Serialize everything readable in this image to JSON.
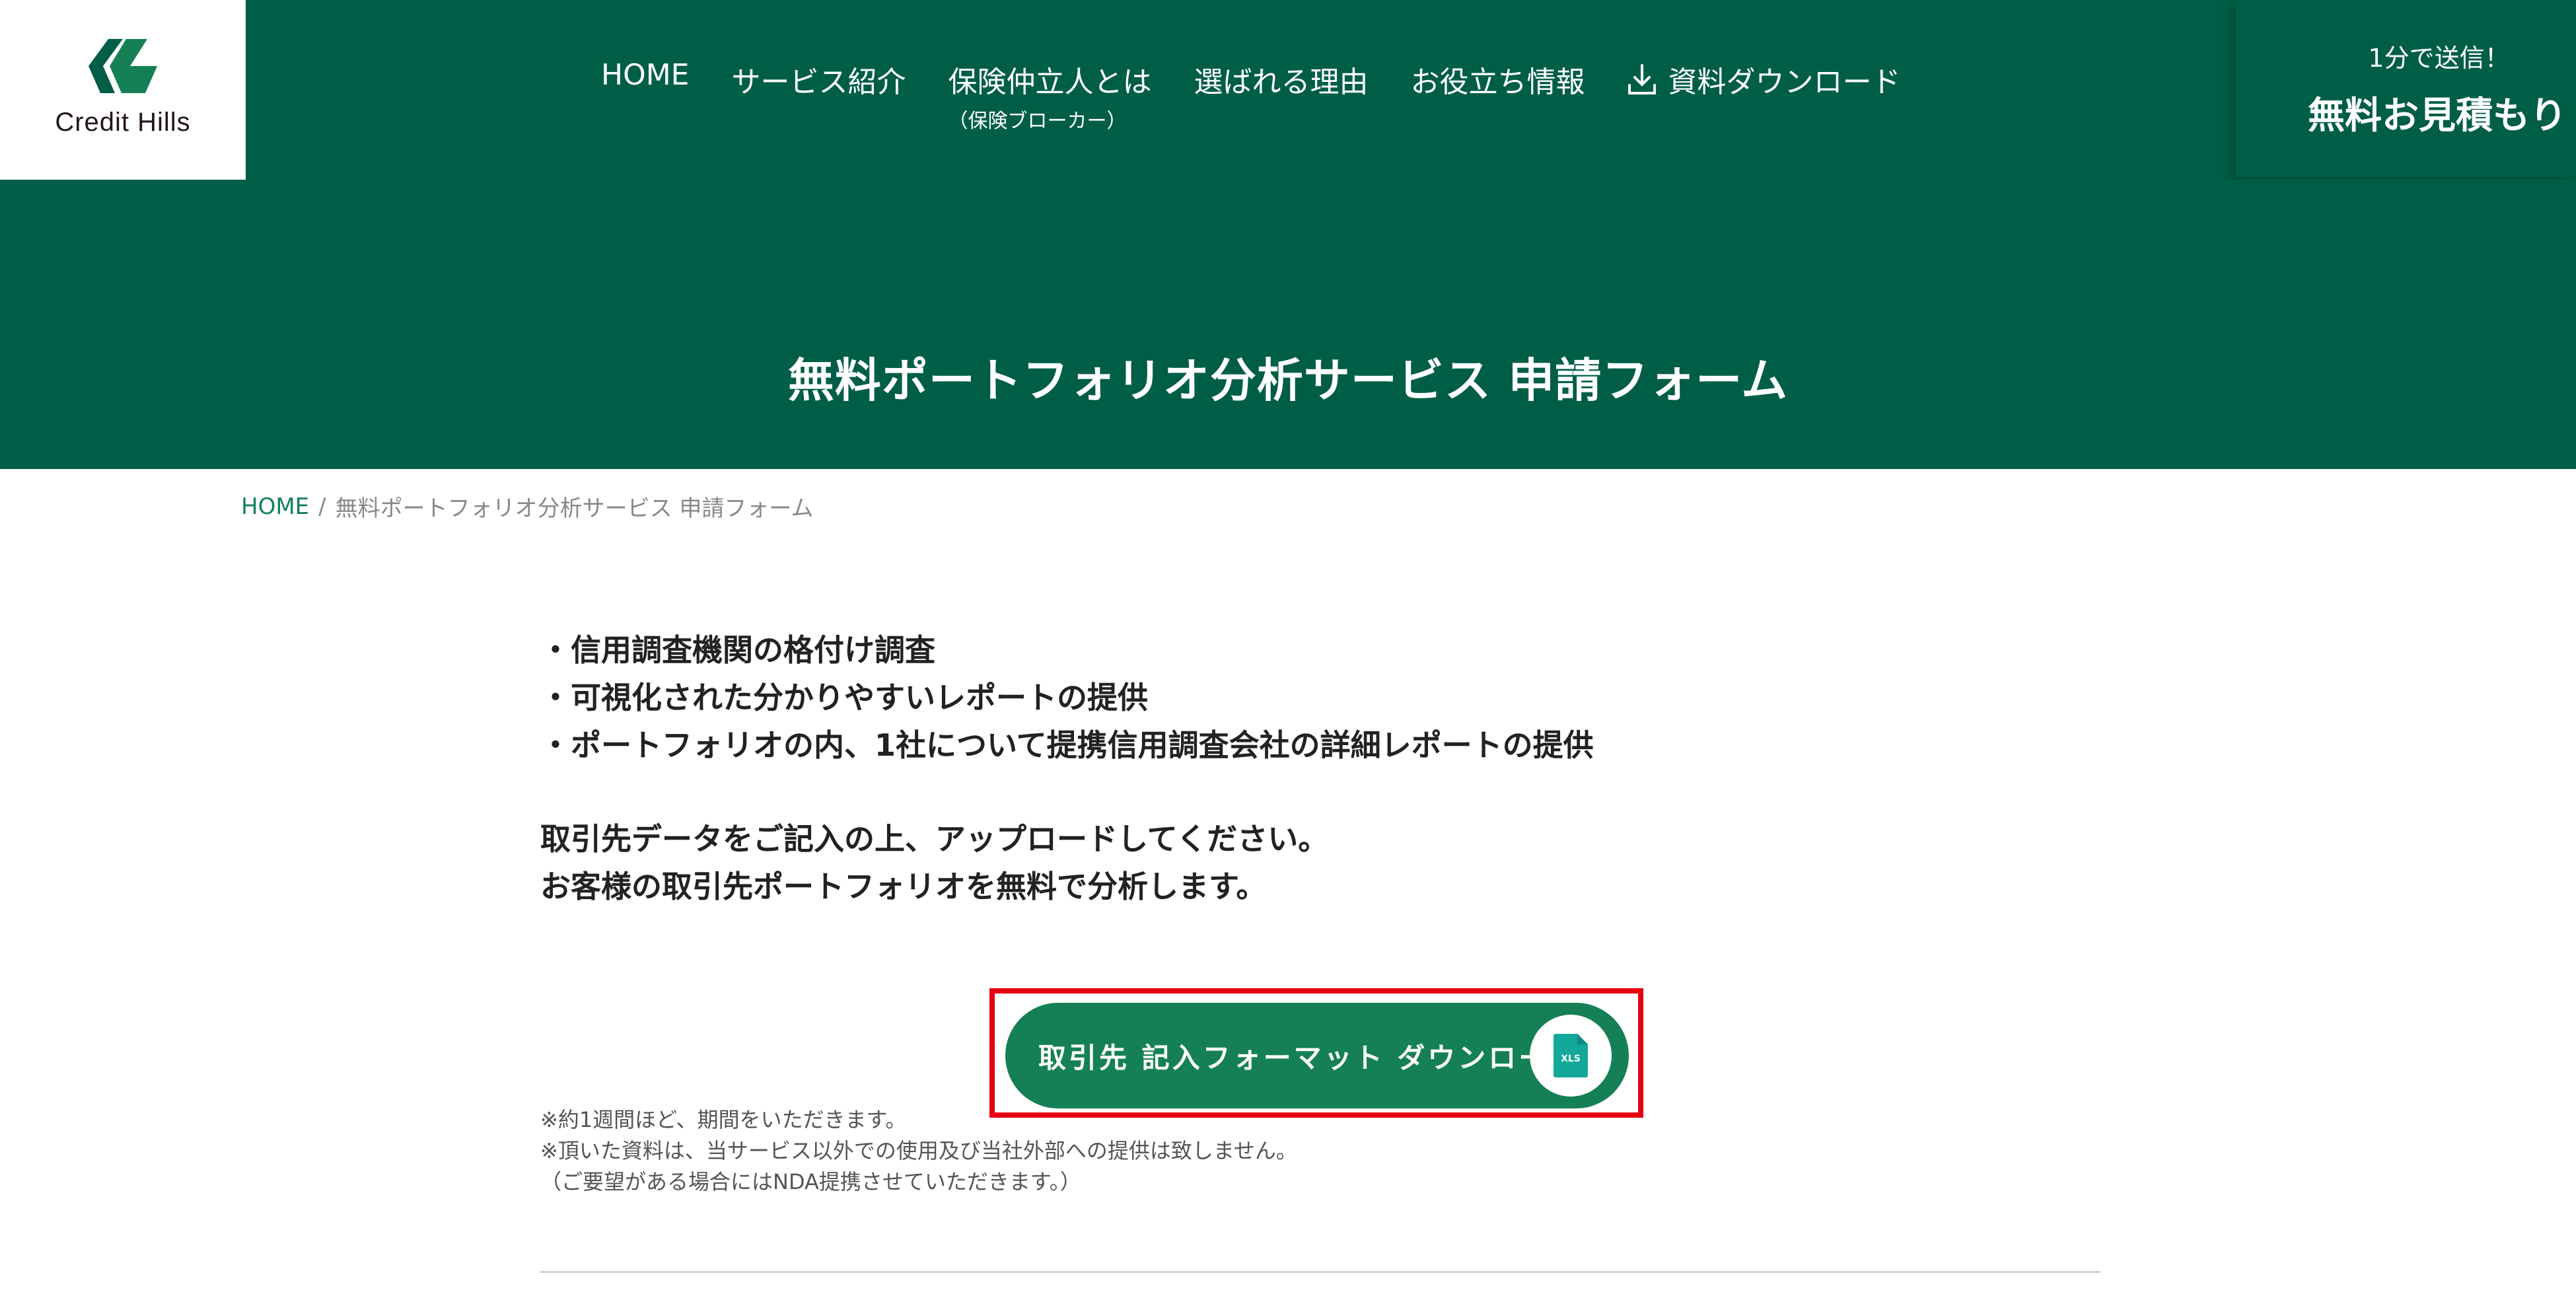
{
  "header": {
    "logo_text": "Credit Hills",
    "nav": [
      {
        "label": "HOME"
      },
      {
        "label": "サービス紹介"
      },
      {
        "label": "保険仲立人とは",
        "sub": "（保険ブローカー）"
      },
      {
        "label": "選ばれる理由"
      },
      {
        "label": "お役立ち情報"
      },
      {
        "label": "資料ダウンロード",
        "icon": "download-icon"
      }
    ],
    "cta": {
      "sub": "1分で送信！",
      "main": "無料お見積もり"
    }
  },
  "hero": {
    "title": "無料ポートフォリオ分析サービス 申請フォーム"
  },
  "breadcrumb": {
    "home": "HOME",
    "separator": "/",
    "current": "無料ポートフォリオ分析サービス 申請フォーム"
  },
  "content": {
    "bullets": [
      "・信用調査機関の格付け調査",
      "・可視化された分かりやすいレポートの提供",
      "・ポートフォリオの内、1社について提携信用調査会社の詳細レポートの提供"
    ],
    "intro": [
      "取引先データをご記入の上、アップロードしてください。",
      "お客様の取引先ポートフォリオを無料で分析します。"
    ],
    "download_button": {
      "label": "取引先 記入フォーマット ダウンロード",
      "icon_label": "XLS"
    },
    "notes": [
      "※約1週間ほど、期間をいただきます。",
      "※頂いた資料は、当サービス以外での使用及び当社外部への提供は致しません。",
      "（ご要望がある場合にはNDA提携させていただきます。）"
    ]
  },
  "colors": {
    "brand": "#005e46",
    "button": "#158055",
    "highlight": "#e60012",
    "xls": "#12a89a"
  }
}
